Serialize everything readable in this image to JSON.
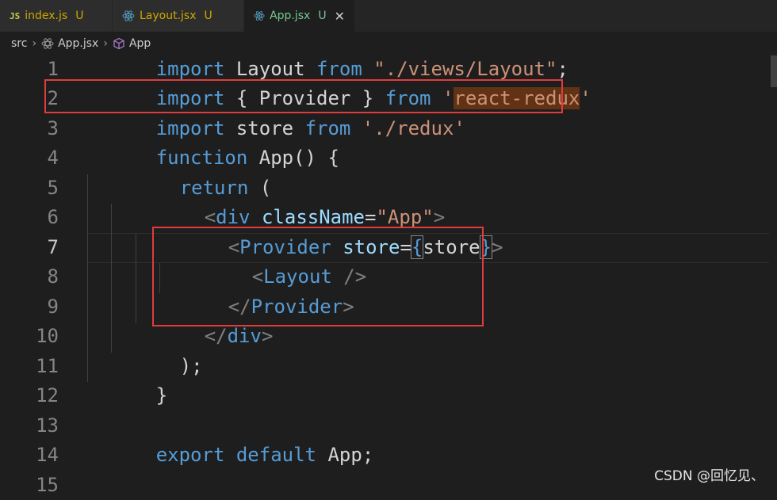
{
  "tabs": [
    {
      "icon": "js-file-icon",
      "label": "index.js",
      "status": "U"
    },
    {
      "icon": "react-file-icon",
      "label": "Layout.jsx",
      "status": "U"
    },
    {
      "icon": "react-file-icon",
      "label": "App.jsx",
      "status": "U",
      "close": "✕"
    }
  ],
  "breadcrumb": {
    "folder": "src",
    "file": "App.jsx",
    "symbol": "App"
  },
  "lines": [
    "1",
    "2",
    "3",
    "4",
    "5",
    "6",
    "7",
    "8",
    "9",
    "10",
    "11",
    "12",
    "13",
    "14",
    "15"
  ],
  "code": {
    "l1": {
      "a": "import",
      "b": " Layout ",
      "c": "from",
      "d": " \"./views/Layout\"",
      "e": ";"
    },
    "l2": {
      "a": "import",
      "b": " { Provider } ",
      "c": "from",
      "d": " '",
      "e": "react-redux",
      "f": "'"
    },
    "l3": {
      "a": "import",
      "b": " store ",
      "c": "from",
      "d": " './redux'"
    },
    "l4": {
      "a": "function",
      "b": " ",
      "c": "App",
      "d": "() {"
    },
    "l5": {
      "a": "return",
      "b": " ("
    },
    "l6": {
      "a": "<",
      "b": "div",
      "c": " className",
      "d": "=",
      "e": "\"App\"",
      "f": ">"
    },
    "l7": {
      "a": "<",
      "b": "Provider",
      "c": " store",
      "d": "=",
      "e": "{",
      "f": "store",
      "g": "}",
      "h": ">"
    },
    "l8": {
      "a": "<",
      "b": "Layout",
      "c": " />"
    },
    "l9": {
      "a": "</",
      "b": "Provider",
      "c": ">"
    },
    "l10": {
      "a": "</",
      "b": "div",
      "c": ">"
    },
    "l11": {
      "a": ");"
    },
    "l12": {
      "a": "}"
    },
    "l14": {
      "a": "export",
      "b": " ",
      "c": "default",
      "d": " App;"
    }
  },
  "watermark": "CSDN @回忆见、"
}
